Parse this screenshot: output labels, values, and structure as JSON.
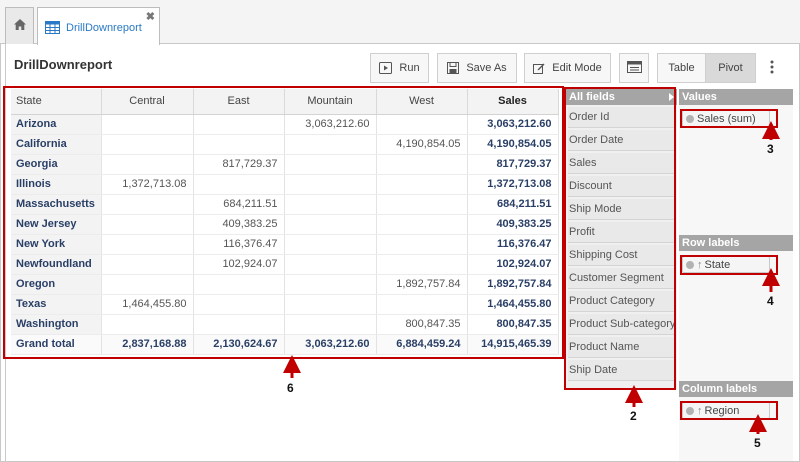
{
  "tabs": {
    "home_icon": "home-icon",
    "report_tab": {
      "label": "DrillDownreport",
      "icon": "grid-icon",
      "close": "✖"
    }
  },
  "report": {
    "title": "DrillDownreport"
  },
  "toolbar": {
    "run_label": "Run",
    "save_as_label": "Save As",
    "edit_mode_label": "Edit Mode",
    "table_label": "Table",
    "pivot_label": "Pivot",
    "more_icon": "kebab-menu-icon"
  },
  "pivot": {
    "headers": [
      "State",
      "Central",
      "East",
      "Mountain",
      "West",
      "Sales"
    ],
    "rows": [
      {
        "state": "Arizona",
        "central": "",
        "east": "",
        "mountain": "3,063,212.60",
        "west": "",
        "sales": "3,063,212.60"
      },
      {
        "state": "California",
        "central": "",
        "east": "",
        "mountain": "",
        "west": "4,190,854.05",
        "sales": "4,190,854.05"
      },
      {
        "state": "Georgia",
        "central": "",
        "east": "817,729.37",
        "mountain": "",
        "west": "",
        "sales": "817,729.37"
      },
      {
        "state": "Illinois",
        "central": "1,372,713.08",
        "east": "",
        "mountain": "",
        "west": "",
        "sales": "1,372,713.08"
      },
      {
        "state": "Massachusetts",
        "central": "",
        "east": "684,211.51",
        "mountain": "",
        "west": "",
        "sales": "684,211.51"
      },
      {
        "state": "New Jersey",
        "central": "",
        "east": "409,383.25",
        "mountain": "",
        "west": "",
        "sales": "409,383.25"
      },
      {
        "state": "New York",
        "central": "",
        "east": "116,376.47",
        "mountain": "",
        "west": "",
        "sales": "116,376.47"
      },
      {
        "state": "Newfoundland",
        "central": "",
        "east": "102,924.07",
        "mountain": "",
        "west": "",
        "sales": "102,924.07"
      },
      {
        "state": "Oregon",
        "central": "",
        "east": "",
        "mountain": "",
        "west": "1,892,757.84",
        "sales": "1,892,757.84"
      },
      {
        "state": "Texas",
        "central": "1,464,455.80",
        "east": "",
        "mountain": "",
        "west": "",
        "sales": "1,464,455.80"
      },
      {
        "state": "Washington",
        "central": "",
        "east": "",
        "mountain": "",
        "west": "800,847.35",
        "sales": "800,847.35"
      }
    ],
    "grand_total": {
      "label": "Grand total",
      "central": "2,837,168.88",
      "east": "2,130,624.67",
      "mountain": "3,063,212.60",
      "west": "6,884,459.24",
      "sales": "14,915,465.39"
    }
  },
  "fields": {
    "header": "All fields",
    "items": [
      "Order Id",
      "Order Date",
      "Sales",
      "Discount",
      "Ship Mode",
      "Profit",
      "Shipping Cost",
      "Customer Segment",
      "Product Category",
      "Product Sub-category",
      "Product Name",
      "Ship Date"
    ]
  },
  "zones": {
    "values": {
      "header": "Values",
      "chip": "Sales (sum)"
    },
    "row_labels": {
      "header": "Row labels",
      "chip": "State"
    },
    "column_labels": {
      "header": "Column labels",
      "chip": "Region"
    }
  },
  "annotations": {
    "callout_2": "2",
    "callout_3": "3",
    "callout_4": "4",
    "callout_5": "5",
    "callout_6": "6",
    "color": "#c00000"
  }
}
